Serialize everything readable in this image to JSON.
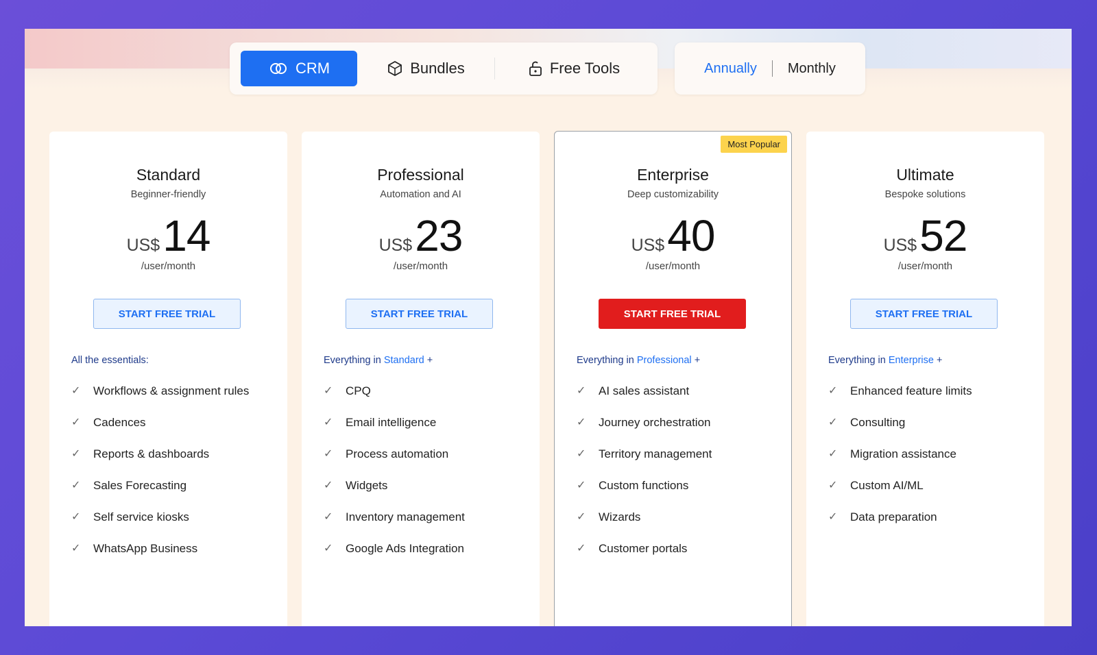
{
  "tabs": {
    "crm_label": "CRM",
    "bundles_label": "Bundles",
    "tools_label": "Free Tools"
  },
  "billing": {
    "annually": "Annually",
    "monthly": "Monthly"
  },
  "colors": {
    "accent": "#1e6ff2",
    "primary_cta": "#e11d1d",
    "badge": "#fcd34d"
  },
  "plans": [
    {
      "name": "Standard",
      "subtitle": "Beginner-friendly",
      "currency": "US$",
      "price": "14",
      "per": "/user/month",
      "cta": "START FREE TRIAL",
      "intro": "All the essentials:",
      "features": [
        "Workflows & assignment rules",
        "Cadences",
        "Reports & dashboards",
        "Sales Forecasting",
        "Self service kiosks",
        "WhatsApp Business"
      ]
    },
    {
      "name": "Professional",
      "subtitle": "Automation and AI",
      "currency": "US$",
      "price": "23",
      "per": "/user/month",
      "cta": "START FREE TRIAL",
      "intro_prefix": "Everything in",
      "intro_plan": "Standard",
      "intro_suffix": "+",
      "features": [
        "CPQ",
        "Email intelligence",
        "Process automation",
        "Widgets",
        "Inventory management",
        "Google Ads Integration"
      ]
    },
    {
      "name": "Enterprise",
      "subtitle": "Deep customizability",
      "currency": "US$",
      "price": "40",
      "per": "/user/month",
      "cta": "START FREE TRIAL",
      "badge": "Most Popular",
      "intro_prefix": "Everything in",
      "intro_plan": "Professional",
      "intro_suffix": "+",
      "features": [
        "AI sales assistant",
        "Journey orchestration",
        "Territory management",
        "Custom functions",
        "Wizards",
        "Customer portals"
      ]
    },
    {
      "name": "Ultimate",
      "subtitle": "Bespoke solutions",
      "currency": "US$",
      "price": "52",
      "per": "/user/month",
      "cta": "START FREE TRIAL",
      "intro_prefix": "Everything in",
      "intro_plan": "Enterprise",
      "intro_suffix": "+",
      "features": [
        "Enhanced feature limits",
        "Consulting",
        "Migration assistance",
        "Custom AI/ML",
        "Data preparation"
      ]
    }
  ]
}
